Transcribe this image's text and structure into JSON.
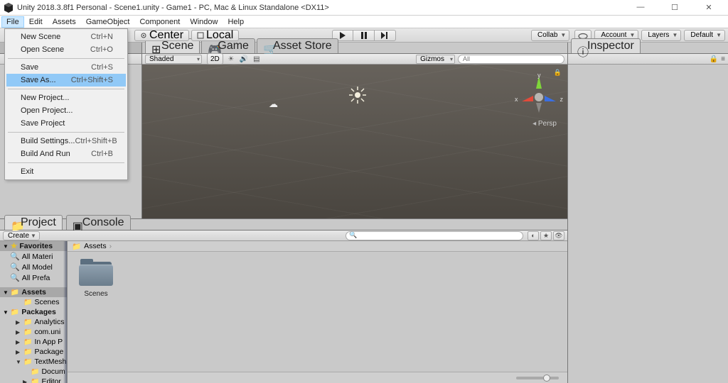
{
  "window": {
    "title": "Unity 2018.3.8f1 Personal - Scene1.unity - Game1 - PC, Mac & Linux Standalone <DX11>"
  },
  "menubar": [
    "File",
    "Edit",
    "Assets",
    "GameObject",
    "Component",
    "Window",
    "Help"
  ],
  "file_menu": {
    "items": [
      {
        "label": "New Scene",
        "shortcut": "Ctrl+N"
      },
      {
        "label": "Open Scene",
        "shortcut": "Ctrl+O"
      },
      {
        "sep": true
      },
      {
        "label": "Save",
        "shortcut": "Ctrl+S"
      },
      {
        "label": "Save As...",
        "shortcut": "Ctrl+Shift+S",
        "highlight": true
      },
      {
        "sep": true
      },
      {
        "label": "New Project..."
      },
      {
        "label": "Open Project..."
      },
      {
        "label": "Save Project"
      },
      {
        "sep": true
      },
      {
        "label": "Build Settings...",
        "shortcut": "Ctrl+Shift+B"
      },
      {
        "label": "Build And Run",
        "shortcut": "Ctrl+B"
      },
      {
        "sep": true
      },
      {
        "label": "Exit"
      }
    ]
  },
  "toolbar": {
    "pivot_center": "Center",
    "pivot_local": "Local",
    "collab": "Collab",
    "account": "Account",
    "layers": "Layers",
    "layout": "Default"
  },
  "scene_tabs": {
    "scene": "Scene",
    "game": "Game",
    "asset_store": "Asset Store"
  },
  "scene_bar": {
    "shading": "Shaded",
    "twod": "2D",
    "gizmos": "Gizmos",
    "search_placeholder": "All"
  },
  "viewport": {
    "axis_x": "x",
    "axis_y": "y",
    "axis_z": "z",
    "persp": "Persp"
  },
  "inspector": {
    "tab": "Inspector"
  },
  "project": {
    "tab_project": "Project",
    "tab_console": "Console",
    "create": "Create",
    "breadcrumb": "Assets",
    "asset_folder": "Scenes",
    "tree": {
      "favorites": "Favorites",
      "fav_items": [
        "All Materi",
        "All Model",
        "All Prefa"
      ],
      "assets": "Assets",
      "assets_children": [
        "Scenes"
      ],
      "packages": "Packages",
      "packages_children": [
        "Analytics",
        "com.uni",
        "In App P",
        "Package",
        "TextMesh"
      ],
      "textmesh_children": [
        "Docum",
        "Editor"
      ]
    }
  }
}
